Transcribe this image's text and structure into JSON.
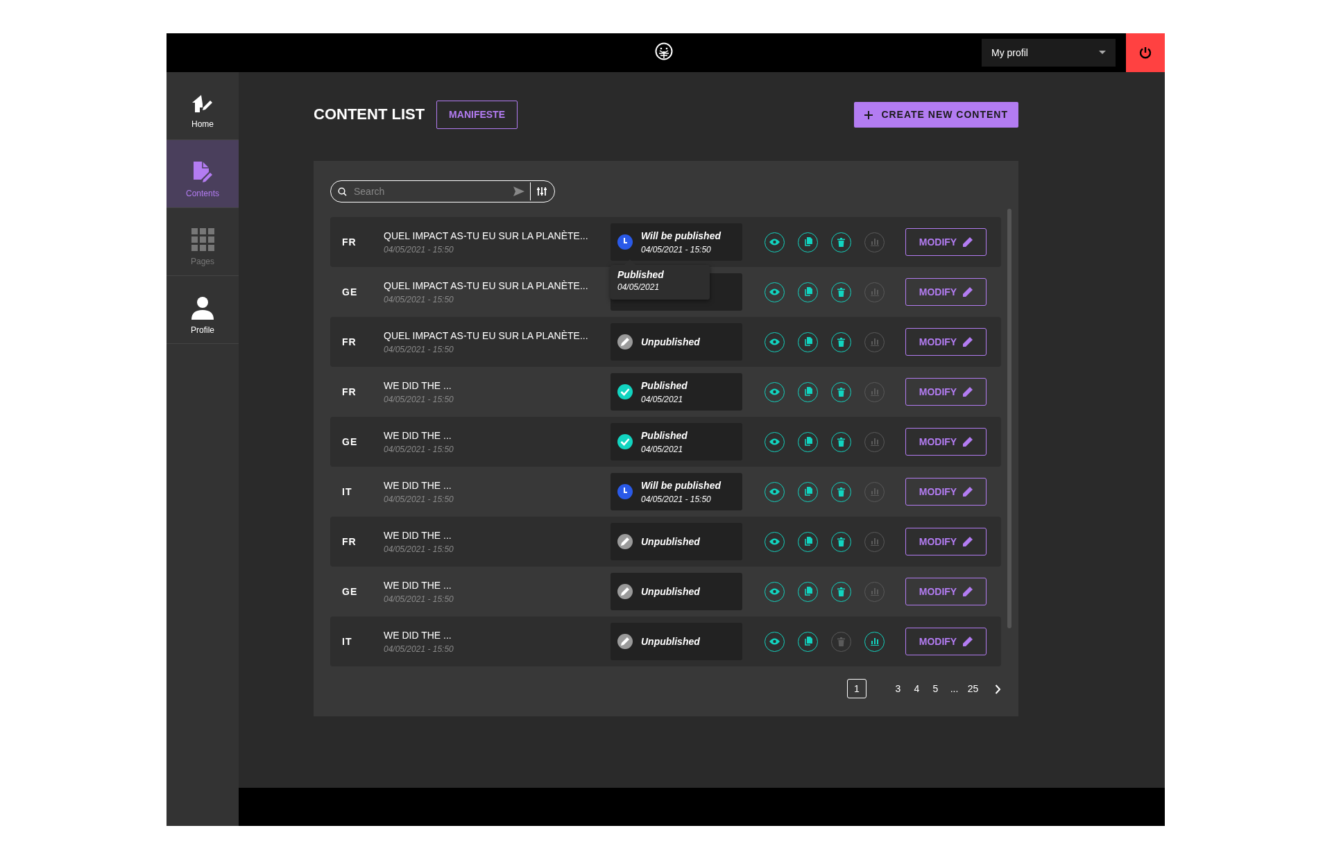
{
  "header": {
    "profile_menu": "My profil"
  },
  "sidebar": {
    "items": [
      {
        "label": "Home",
        "selected": false,
        "disabled": false
      },
      {
        "label": "Contents",
        "selected": true,
        "disabled": false
      },
      {
        "label": "Pages",
        "selected": false,
        "disabled": true
      },
      {
        "label": "Profile",
        "selected": false,
        "disabled": false
      }
    ]
  },
  "page": {
    "title": "CONTENT LIST",
    "tag_button": "MANIFESTE",
    "create_button": "CREATE NEW CONTENT"
  },
  "search": {
    "placeholder": "Search"
  },
  "rows": [
    {
      "language": "FR",
      "title": "QUEL IMPACT AS-TU EU SUR LA PLANÈTE...",
      "date": "04/05/2021 - 15:50",
      "status": {
        "kind": "scheduled",
        "label": "Will be published",
        "date": "04/05/2021 - 15:50"
      },
      "actions": [
        {
          "disabled": false
        },
        {
          "disabled": false
        },
        {
          "disabled": false
        },
        {
          "disabled": true
        }
      ],
      "button": "MODIFY"
    },
    {
      "language": "GE",
      "title": "QUEL IMPACT AS-TU EU SUR LA PLANÈTE...",
      "date": "04/05/2021 - 15:50",
      "actions": [
        {
          "disabled": false
        },
        {
          "disabled": false
        },
        {
          "disabled": false
        },
        {
          "disabled": true
        }
      ],
      "button": "MODIFY"
    },
    {
      "language": "FR",
      "title": "QUEL IMPACT AS-TU EU SUR LA PLANÈTE...",
      "date": "04/05/2021 - 15:50",
      "status": {
        "kind": "unpublished",
        "label": "Unpublished"
      },
      "actions": [
        {
          "disabled": false
        },
        {
          "disabled": false
        },
        {
          "disabled": false
        },
        {
          "disabled": true
        }
      ],
      "button": "MODIFY"
    },
    {
      "language": "FR",
      "title": "WE DID THE ...",
      "date": "04/05/2021 - 15:50",
      "status": {
        "kind": "published",
        "label": "Published",
        "date": "04/05/2021"
      },
      "actions": [
        {
          "disabled": false
        },
        {
          "disabled": false
        },
        {
          "disabled": false
        },
        {
          "disabled": true
        }
      ],
      "button": "MODIFY"
    },
    {
      "language": "GE",
      "title": "WE DID THE ...",
      "date": "04/05/2021 - 15:50",
      "status": {
        "kind": "published",
        "label": "Published",
        "date": "04/05/2021"
      },
      "actions": [
        {
          "disabled": false
        },
        {
          "disabled": false
        },
        {
          "disabled": false
        },
        {
          "disabled": true
        }
      ],
      "button": "MODIFY"
    },
    {
      "language": "IT",
      "title": "WE DID THE ...",
      "date": "04/05/2021 - 15:50",
      "status": {
        "kind": "scheduled",
        "label": "Will be published",
        "date": "04/05/2021 - 15:50"
      },
      "actions": [
        {
          "disabled": false
        },
        {
          "disabled": false
        },
        {
          "disabled": false
        },
        {
          "disabled": true
        }
      ],
      "button": "MODIFY"
    },
    {
      "language": "FR",
      "title": "WE DID THE ...",
      "date": "04/05/2021 - 15:50",
      "status": {
        "kind": "unpublished",
        "label": "Unpublished"
      },
      "actions": [
        {
          "disabled": false
        },
        {
          "disabled": false
        },
        {
          "disabled": false
        },
        {
          "disabled": true
        }
      ],
      "button": "MODIFY"
    },
    {
      "language": "GE",
      "title": "WE DID THE ...",
      "date": "04/05/2021 - 15:50",
      "status": {
        "kind": "unpublished",
        "label": "Unpublished"
      },
      "actions": [
        {
          "disabled": false
        },
        {
          "disabled": false
        },
        {
          "disabled": false
        },
        {
          "disabled": true
        }
      ],
      "button": "MODIFY"
    },
    {
      "language": "IT",
      "title": "WE DID THE ...",
      "date": "04/05/2021 - 15:50",
      "status": {
        "kind": "unpublished",
        "label": "Unpublished"
      },
      "actions": [
        {
          "disabled": false
        },
        {
          "disabled": false
        },
        {
          "disabled": true
        },
        {
          "disabled": false
        }
      ],
      "button": "MODIFY"
    }
  ],
  "tooltip": {
    "label": "Published",
    "date": "04/05/2021"
  },
  "pagination": {
    "pages": [
      {
        "label": "1",
        "selected": true
      },
      {
        "label": "3",
        "selected": false
      },
      {
        "label": "4",
        "selected": false
      },
      {
        "label": "5",
        "selected": false
      },
      {
        "label": "...",
        "selected": false
      },
      {
        "label": "25",
        "selected": false
      }
    ]
  }
}
